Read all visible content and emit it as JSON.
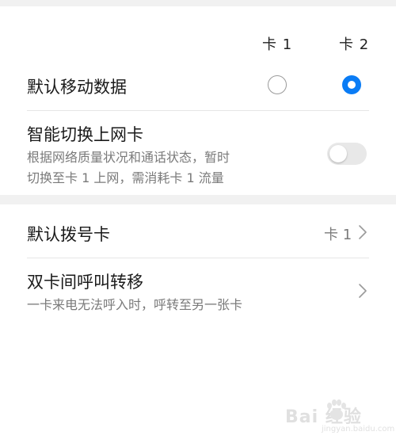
{
  "header": {
    "card1_label": "卡 1",
    "card2_label": "卡 2"
  },
  "default_data": {
    "title": "默认移动数据",
    "card1_selected": false,
    "card2_selected": true
  },
  "smart_switch": {
    "title": "智能切换上网卡",
    "description_line1": "根据网络质量状况和通话状态，暂时",
    "description_line2": "切换至卡 1 上网，需消耗卡 1 流量",
    "enabled": false
  },
  "default_dial": {
    "title": "默认拨号卡",
    "value": "卡 1"
  },
  "call_forward": {
    "title": "双卡间呼叫转移",
    "description": "一卡来电无法呼入时，呼转至另一张卡"
  },
  "watermark": {
    "brand": "Bai 经验",
    "url": "jingyan.baidu.com"
  },
  "colors": {
    "accent": "#0a7cf5",
    "section_gap": "#f1f1f1"
  }
}
